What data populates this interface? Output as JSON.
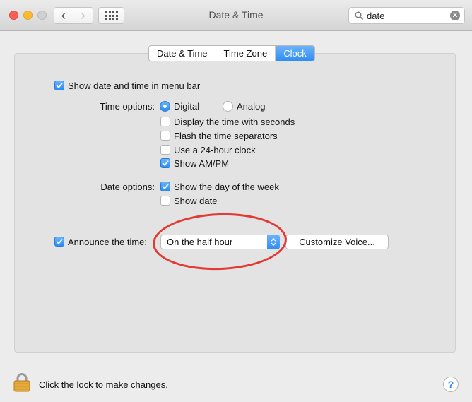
{
  "window": {
    "title": "Date & Time",
    "search_value": "date",
    "clear_glyph": "✕",
    "back_glyph": "‹",
    "forward_glyph": "›"
  },
  "tabs": [
    {
      "label": "Date & Time",
      "active": false
    },
    {
      "label": "Time Zone",
      "active": false
    },
    {
      "label": "Clock",
      "active": true
    }
  ],
  "clock": {
    "show_in_menu_bar": {
      "label": "Show date and time in menu bar",
      "checked": true
    },
    "time_options_label": "Time options:",
    "digital": {
      "label": "Digital",
      "selected": true
    },
    "analog": {
      "label": "Analog",
      "selected": false
    },
    "display_seconds": {
      "label": "Display the time with seconds",
      "checked": false
    },
    "flash_separators": {
      "label": "Flash the time separators",
      "checked": false
    },
    "use_24_hour": {
      "label": "Use a 24-hour clock",
      "checked": false
    },
    "show_ampm": {
      "label": "Show AM/PM",
      "checked": true
    },
    "date_options_label": "Date options:",
    "show_day_of_week": {
      "label": "Show the day of the week",
      "checked": true
    },
    "show_date": {
      "label": "Show date",
      "checked": false
    },
    "announce_time": {
      "label": "Announce the time:",
      "checked": true
    },
    "announce_interval": "On the half hour",
    "customize_voice": "Customize Voice..."
  },
  "footer": {
    "lock_text": "Click the lock to make changes.",
    "help_glyph": "?"
  },
  "colors": {
    "accent": "#2d8ef3",
    "annotation": "#e23a34"
  }
}
